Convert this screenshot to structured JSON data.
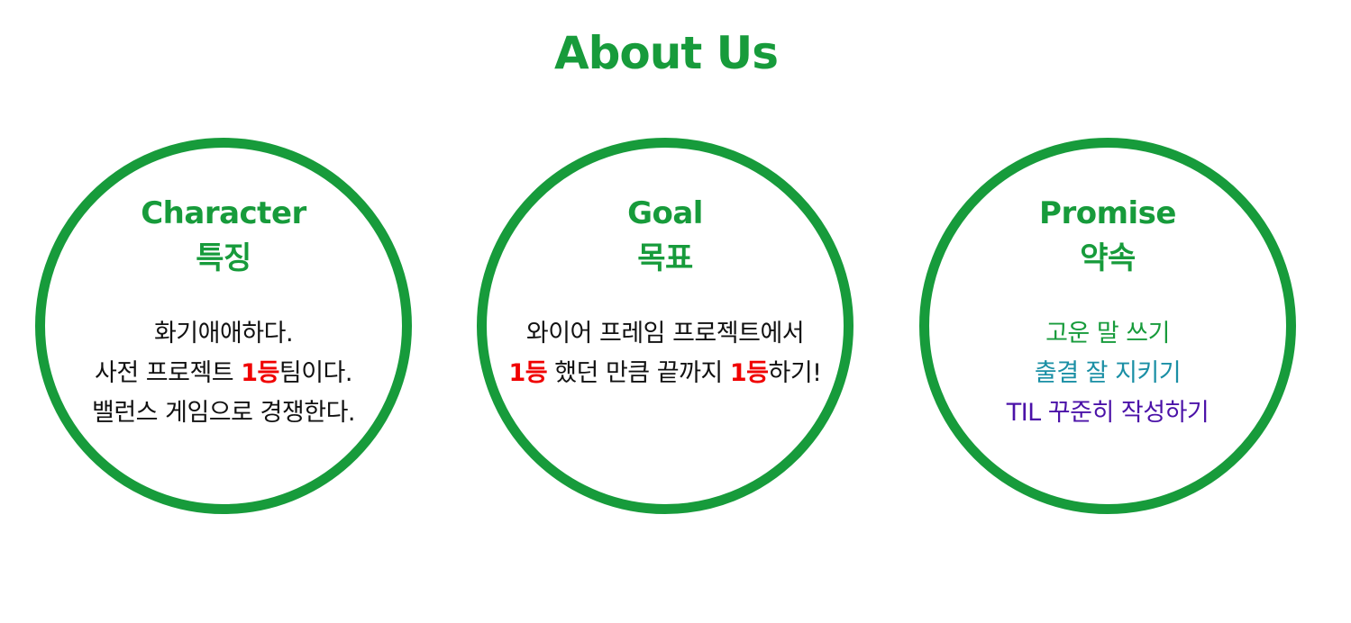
{
  "colors": {
    "accent": "#179b3b",
    "highlight": "#f00000",
    "text": "#111111",
    "promise_line1": "#179b3b",
    "promise_line2": "#1a8fa5",
    "promise_line3": "#4b12a8"
  },
  "header": {
    "title": "About Us"
  },
  "sections": [
    {
      "title_en": "Character",
      "title_ko": "특징",
      "lines": [
        {
          "parts": [
            {
              "text": "화기애애하다."
            }
          ]
        },
        {
          "parts": [
            {
              "text": "사전 프로젝트 "
            },
            {
              "text": "1등",
              "highlight": true
            },
            {
              "text": "팀이다."
            }
          ]
        },
        {
          "parts": [
            {
              "text": "밸런스 게임으로 경쟁한다."
            }
          ]
        }
      ]
    },
    {
      "title_en": "Goal",
      "title_ko": "목표",
      "lines": [
        {
          "parts": [
            {
              "text": "와이어 프레임 프로젝트에서"
            }
          ]
        },
        {
          "parts": [
            {
              "text": "1등",
              "highlight": true
            },
            {
              "text": " 했던 만큼 끝까지 "
            },
            {
              "text": "1등",
              "highlight": true
            },
            {
              "text": "하기!"
            }
          ]
        }
      ]
    },
    {
      "title_en": "Promise",
      "title_ko": "약속",
      "lines": [
        {
          "parts": [
            {
              "text": "고운 말 쓰기"
            }
          ],
          "color": "#179b3b"
        },
        {
          "parts": [
            {
              "text": "출결 잘 지키기"
            }
          ],
          "color": "#1a8fa5"
        },
        {
          "parts": [
            {
              "text": "TIL 꾸준히 작성하기"
            }
          ],
          "color": "#4b12a8"
        }
      ]
    }
  ]
}
